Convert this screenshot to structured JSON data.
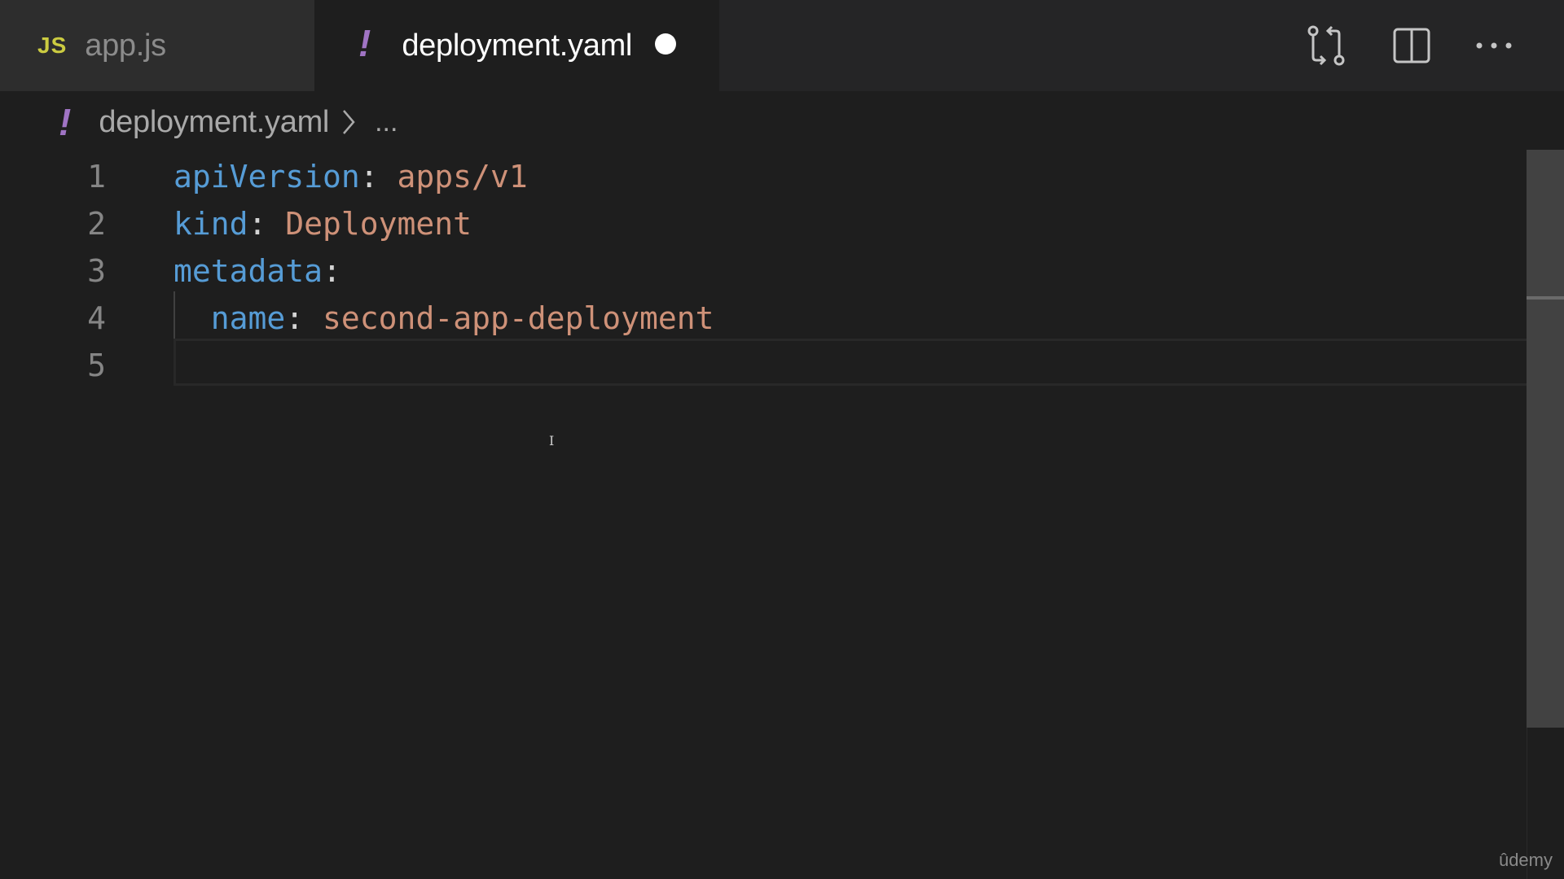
{
  "tabs": [
    {
      "icon": "JS",
      "label": "app.js",
      "active": false
    },
    {
      "icon": "!",
      "label": "deployment.yaml",
      "active": true,
      "dirty": true
    }
  ],
  "actions": {
    "compare_icon": "git-compare-icon",
    "split_icon": "split-editor-icon",
    "more_icon": "more-actions-icon",
    "more_glyph": "···"
  },
  "breadcrumb": {
    "icon": "!",
    "file": "deployment.yaml",
    "more": "..."
  },
  "editor": {
    "lines": [
      {
        "number": "1",
        "key": "apiVersion",
        "colon": ":",
        "value": " apps/v1"
      },
      {
        "number": "2",
        "key": "kind",
        "colon": ":",
        "value": " Deployment"
      },
      {
        "number": "3",
        "key": "metadata",
        "colon": ":",
        "value": ""
      },
      {
        "number": "4",
        "key": "  name",
        "colon": ":",
        "value": " second-app-deployment"
      },
      {
        "number": "5",
        "key": "",
        "colon": "",
        "value": ""
      }
    ]
  },
  "watermark": "ûdemy",
  "colors": {
    "yaml_icon": "#a074c4",
    "js_icon": "#cbcb41",
    "key": "#569cd6",
    "value": "#ce9178",
    "background": "#1e1e1e"
  }
}
